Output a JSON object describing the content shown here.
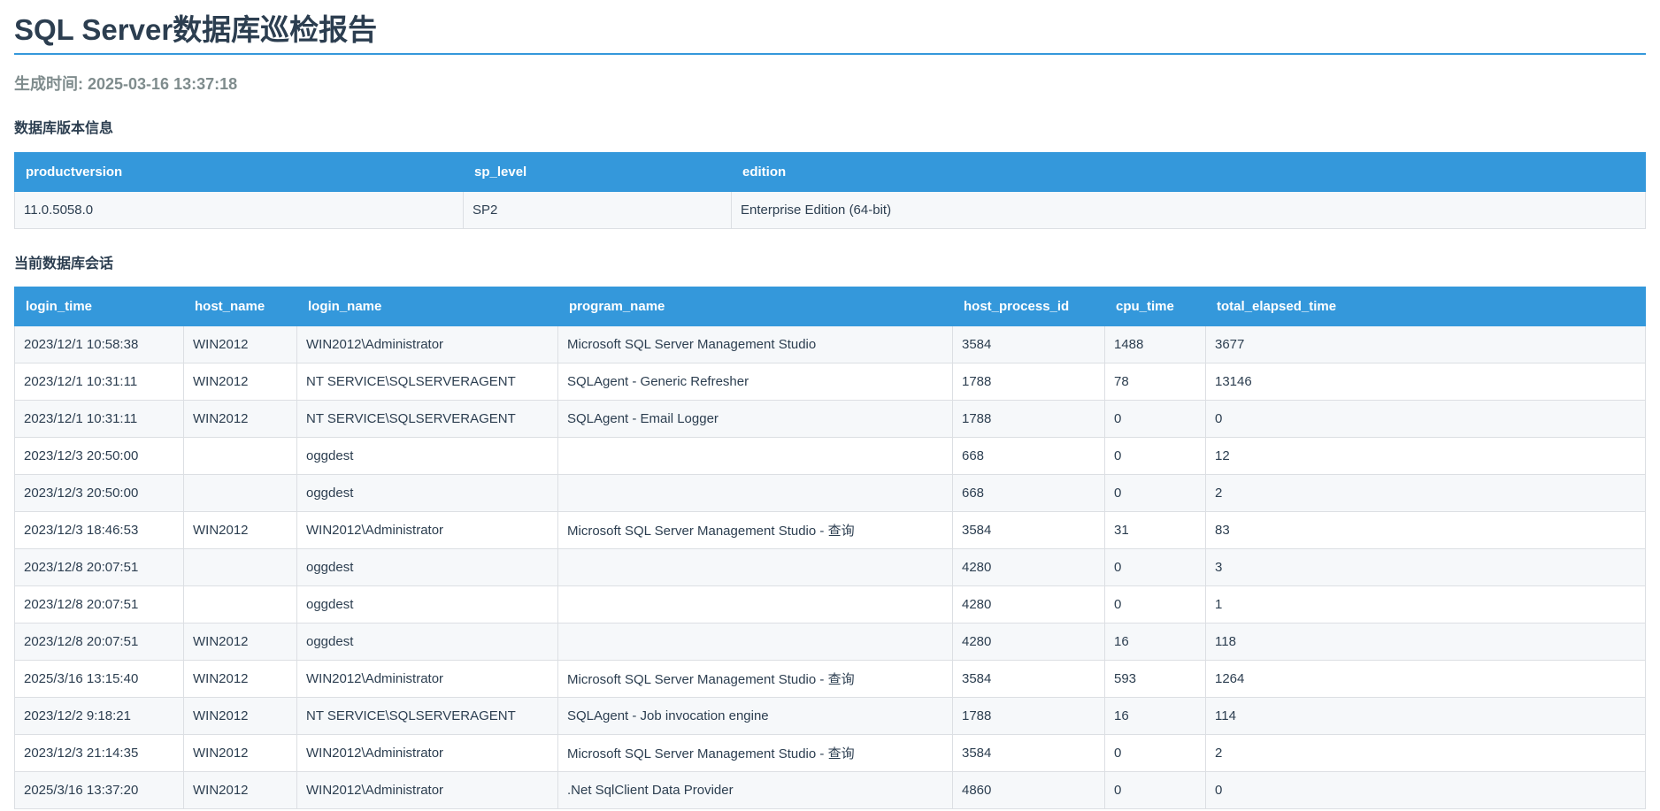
{
  "report": {
    "title": "SQL Server数据库巡检报告",
    "generated": "生成时间: 2025-03-16 13:37:18"
  },
  "version_section": {
    "title": "数据库版本信息",
    "headers": [
      "productversion",
      "sp_level",
      "edition"
    ],
    "rows": [
      [
        "11.0.5058.0",
        "SP2",
        "Enterprise Edition (64-bit)"
      ]
    ]
  },
  "session_section": {
    "title": "当前数据库会话",
    "headers": [
      "login_time",
      "host_name",
      "login_name",
      "program_name",
      "host_process_id",
      "cpu_time",
      "total_elapsed_time"
    ],
    "rows": [
      [
        "2023/12/1 10:58:38",
        "WIN2012",
        "WIN2012\\Administrator",
        "Microsoft SQL Server Management Studio",
        "3584",
        "1488",
        "3677"
      ],
      [
        "2023/12/1 10:31:11",
        "WIN2012",
        "NT SERVICE\\SQLSERVERAGENT",
        "SQLAgent - Generic Refresher",
        "1788",
        "78",
        "13146"
      ],
      [
        "2023/12/1 10:31:11",
        "WIN2012",
        "NT SERVICE\\SQLSERVERAGENT",
        "SQLAgent - Email Logger",
        "1788",
        "0",
        "0"
      ],
      [
        "2023/12/3 20:50:00",
        "",
        "oggdest",
        "",
        "668",
        "0",
        "12"
      ],
      [
        "2023/12/3 20:50:00",
        "",
        "oggdest",
        "",
        "668",
        "0",
        "2"
      ],
      [
        "2023/12/3 18:46:53",
        "WIN2012",
        "WIN2012\\Administrator",
        "Microsoft SQL Server Management Studio - 查询",
        "3584",
        "31",
        "83"
      ],
      [
        "2023/12/8 20:07:51",
        "",
        "oggdest",
        "",
        "4280",
        "0",
        "3"
      ],
      [
        "2023/12/8 20:07:51",
        "",
        "oggdest",
        "",
        "4280",
        "0",
        "1"
      ],
      [
        "2023/12/8 20:07:51",
        "WIN2012",
        "oggdest",
        "",
        "4280",
        "16",
        "118"
      ],
      [
        "2025/3/16 13:15:40",
        "WIN2012",
        "WIN2012\\Administrator",
        "Microsoft SQL Server Management Studio - 查询",
        "3584",
        "593",
        "1264"
      ],
      [
        "2023/12/2 9:18:21",
        "WIN2012",
        "NT SERVICE\\SQLSERVERAGENT",
        "SQLAgent - Job invocation engine",
        "1788",
        "16",
        "114"
      ],
      [
        "2023/12/3 21:14:35",
        "WIN2012",
        "WIN2012\\Administrator",
        "Microsoft SQL Server Management Studio - 查询",
        "3584",
        "0",
        "2"
      ],
      [
        "2025/3/16 13:37:20",
        "WIN2012",
        "WIN2012\\Administrator",
        ".Net SqlClient Data Provider",
        "4860",
        "0",
        "0"
      ]
    ]
  }
}
